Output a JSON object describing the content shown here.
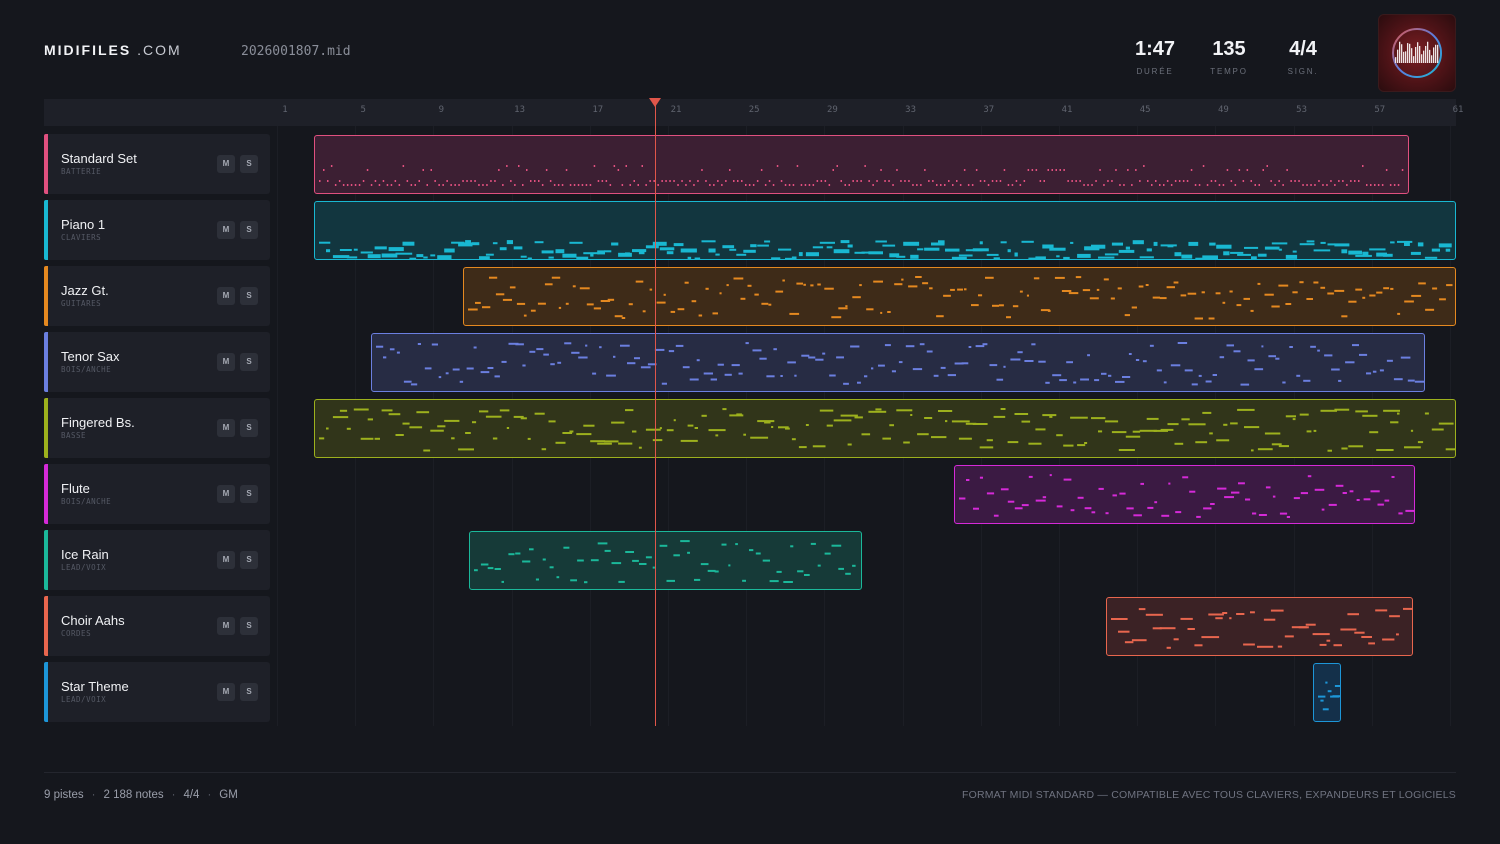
{
  "brand": {
    "name": "MIDIFILES",
    "domain": ".COM"
  },
  "file": {
    "name": "2026001807.mid"
  },
  "stats": [
    {
      "value": "1:47",
      "label": "DURÉE"
    },
    {
      "value": "135",
      "label": "TEMPO"
    },
    {
      "value": "4/4",
      "label": "SIGN."
    }
  ],
  "ruler": {
    "ticks": [
      "1",
      "5",
      "9",
      "13",
      "17",
      "21",
      "25",
      "29",
      "33",
      "37",
      "41",
      "45",
      "49",
      "53",
      "57",
      "61"
    ]
  },
  "playhead": {
    "bar": 19.8
  },
  "tracks": [
    {
      "name": "Standard Set",
      "category": "BATTERIE",
      "color": "#e0507f",
      "fill": "#3c1f33",
      "mute": "M",
      "solo": "S",
      "start_bar": 2.5,
      "end_bar": 58.5
    },
    {
      "name": "Piano 1",
      "category": "CLAVIERS",
      "color": "#19b8d2",
      "fill": "#12363f",
      "mute": "M",
      "solo": "S",
      "start_bar": 2.5,
      "end_bar": 61.8
    },
    {
      "name": "Jazz Gt.",
      "category": "GUITARES",
      "color": "#e58920",
      "fill": "#3e2b18",
      "mute": "M",
      "solo": "S",
      "start_bar": 10.1,
      "end_bar": 61.8
    },
    {
      "name": "Tenor Sax",
      "category": "BOIS/ANCHE",
      "color": "#6b7fe0",
      "fill": "#272c44",
      "mute": "M",
      "solo": "S",
      "start_bar": 5.4,
      "end_bar": 59.3
    },
    {
      "name": "Fingered Bs.",
      "category": "BASSE",
      "color": "#9db11d",
      "fill": "#31351a",
      "mute": "M",
      "solo": "S",
      "start_bar": 2.5,
      "end_bar": 60.9
    },
    {
      "name": "Flute",
      "category": "BOIS/ANCHE",
      "color": "#d52ad8",
      "fill": "#3b1a43",
      "mute": "M",
      "solo": "S",
      "start_bar": 35.2,
      "end_bar": 58.8
    },
    {
      "name": "Ice Rain",
      "category": "LEAD/VOIX",
      "color": "#1bb89a",
      "fill": "#163a38",
      "mute": "M",
      "solo": "S",
      "start_bar": 10.4,
      "end_bar": 30.5
    },
    {
      "name": "Choir Aahs",
      "category": "CORDES",
      "color": "#e8664e",
      "fill": "#3b2225",
      "mute": "M",
      "solo": "S",
      "start_bar": 43.0,
      "end_bar": 58.7
    },
    {
      "name": "Star Theme",
      "category": "LEAD/VOIX",
      "color": "#1d96d8",
      "fill": "#14304a",
      "mute": "M",
      "solo": "S",
      "start_bar": 53.6,
      "end_bar": 55.0
    }
  ],
  "footer": {
    "tracks": "9 pistes",
    "notes": "2 188 notes",
    "signature": "4/4",
    "standard": "GM",
    "separator": "·",
    "note": "FORMAT MIDI STANDARD — COMPATIBLE AVEC TOUS CLAVIERS, EXPANDEURS ET LOGICIELS"
  }
}
